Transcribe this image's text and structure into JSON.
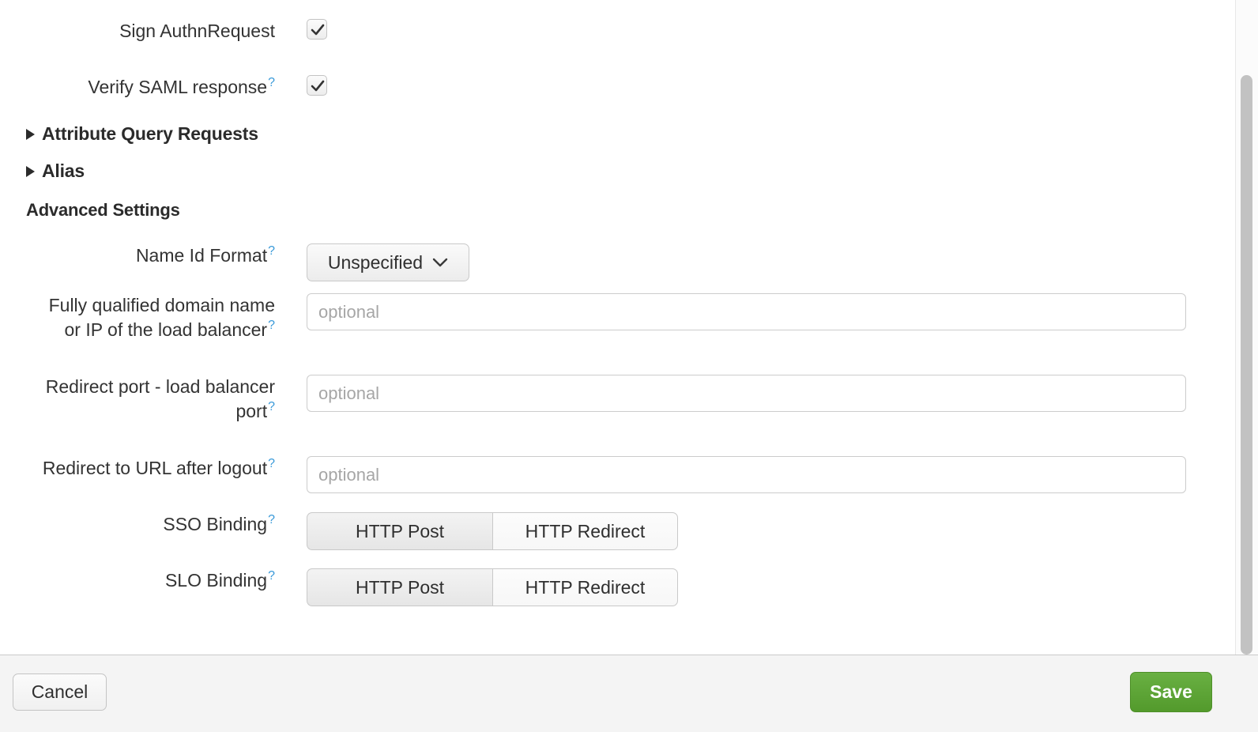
{
  "form": {
    "rows": [
      {
        "label": "Sign AuthnRequest",
        "has_help": false,
        "checked": true
      },
      {
        "label": "Verify SAML response",
        "has_help": true,
        "checked": true
      }
    ],
    "sections": [
      {
        "label": "Attribute Query Requests",
        "expanded": false
      },
      {
        "label": "Alias",
        "expanded": false
      }
    ],
    "advanced_heading": "Advanced Settings",
    "name_id_format": {
      "label": "Name Id Format",
      "value": "Unspecified",
      "chevron": "chevron-down-icon"
    },
    "fqdn": {
      "label": "Fully qualified domain name\nor IP of the load balancer",
      "value": "",
      "placeholder": "optional"
    },
    "redirect_port": {
      "label": "Redirect port - load balancer\nport",
      "value": "",
      "placeholder": "optional"
    },
    "redirect_logout": {
      "label": "Redirect to URL after logout",
      "value": "",
      "placeholder": "optional"
    },
    "sso_binding": {
      "label": "SSO Binding",
      "options": [
        "HTTP Post",
        "HTTP Redirect"
      ],
      "selected": "HTTP Post"
    },
    "slo_binding": {
      "label": "SLO Binding",
      "options": [
        "HTTP Post",
        "HTTP Redirect"
      ],
      "selected": "HTTP Post"
    },
    "help_marker": "?"
  },
  "footer": {
    "cancel_label": "Cancel",
    "save_label": "Save"
  },
  "colors": {
    "help_blue": "#3a9ad9",
    "save_green": "#539a2c",
    "footer_bg": "#f4f4f4",
    "scrollbar_thumb": "#c2c2c2"
  }
}
